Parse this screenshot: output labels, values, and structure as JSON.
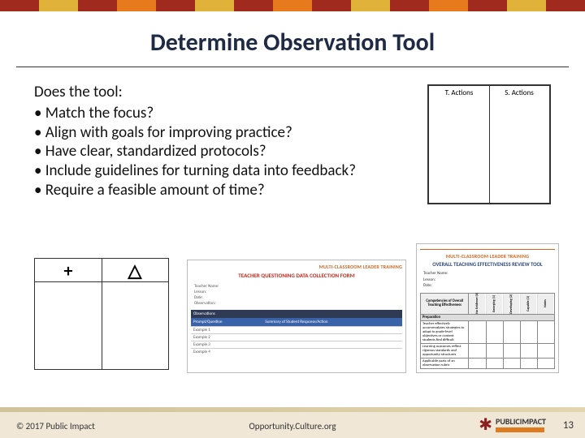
{
  "topbar_colors": [
    "#a02a1e",
    "#e0b23a",
    "#a02a1e",
    "#e87a1e",
    "#a02a1e",
    "#e0b23a",
    "#a02a1e",
    "#e87a1e",
    "#a02a1e",
    "#e0b23a",
    "#a02a1e",
    "#e87a1e",
    "#a02a1e",
    "#e0b23a",
    "#a02a1e"
  ],
  "title": "Determine Observation Tool",
  "intro": "Does the tool:",
  "bullets": [
    "Match the focus?",
    "Align with goals for improving practice?",
    "Have clear, standardized protocols?",
    "Include guidelines for turning data into feedback?",
    "Require a feasible amount of time?"
  ],
  "tchart": {
    "left": "T. Actions",
    "right": "S. Actions"
  },
  "plusdelta": {
    "left": "+",
    "right": "△"
  },
  "form1": {
    "banner": "MULTI-CLASSROOM LEADER TRAINING",
    "title": "TEACHER QUESTIONING DATA COLLECTION FORM",
    "meta": [
      "Teacher Name:",
      "Lesson:",
      "Date:",
      "Observation:"
    ],
    "dark_header": "Observations",
    "cols": [
      "Prompt/Question",
      "Summary of Student Response/Action"
    ],
    "rows": [
      "Example 1",
      "Example 2",
      "Example 3",
      "Example 4"
    ]
  },
  "form2": {
    "banner": "MULTI-CLASSROOM LEADER TRAINING",
    "title": "OVERALL TEACHING EFFECTIVENESS REVIEW TOOL",
    "meta": [
      "Teacher Name:",
      "Lesson:",
      "Date:"
    ],
    "col_headers": [
      "No Evidence (0)",
      "Emerging (1)",
      "Developing (2)",
      "Capable (3)",
      "Notes"
    ],
    "row_label": "Competencies of Overall Teaching Effectiveness",
    "sub": "Preparation",
    "body_rows": [
      "Teacher effectively accommodates strategies to adapt to grade-level objectives or content students find difficult",
      "Learning outcomes reflect rigorous standards and opportunity structures",
      "Applicable parts of an observation rubric"
    ]
  },
  "footer": {
    "copyright": "© 2017 Public Impact",
    "center": "Opportunity.Culture.org",
    "logo_top": "PUBLIC",
    "logo_bottom": "IMPACT",
    "page": "13"
  }
}
